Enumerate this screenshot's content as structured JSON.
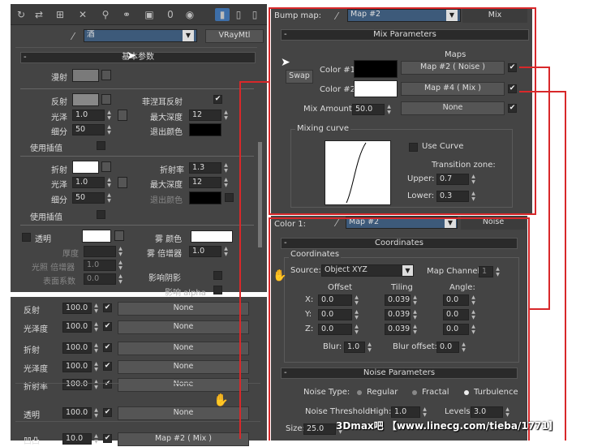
{
  "left": {
    "toolbar_icons": [
      "eyedropper-icon",
      "put-to-scene-icon",
      "assign-icon",
      "reset-icon",
      "copy-icon",
      "unique-icon",
      "put-library-icon",
      "effects-channel-icon",
      "show-map-icon",
      "show-end-icon",
      "go-parent-icon"
    ],
    "effects_channel": "0",
    "material_name": "酒",
    "material_type": "VRayMtl",
    "rollout_title": "基本参数",
    "diffuse_label": "漫射",
    "reflect_label": "反射",
    "fresnel_label": "菲涅耳反射",
    "gloss_label": "光泽",
    "gloss_value": "1.0",
    "max_depth_label": "最大深度",
    "max_depth_value": "12",
    "subdiv_label": "细分",
    "subdiv_value": "50",
    "exit_color_label": "退出颜色",
    "use_interp_label": "使用插值",
    "refract_label": "折射",
    "ior_label": "折射率",
    "ior_value": "1.3",
    "r_gloss_value": "1.0",
    "r_max_depth_value": "12",
    "r_subdiv_value": "50",
    "r_exit_color_label": "退出颜色",
    "r_use_interp_label": "使用插值",
    "translucent_label": "透明",
    "fog_color_label": "雾 颜色",
    "thickness_label": "厚度",
    "fog_mult_label": "雾 倍增器",
    "fog_mult_value": "1.0",
    "light_mult_label": "光照 倍增器",
    "light_mult_value": "1.0",
    "surface_label": "表面系数",
    "surface_value": "0.0",
    "shadow_label": "影响阴影",
    "affect_alpha_label": "影响 alpha"
  },
  "maps": {
    "rows": [
      {
        "label": "反射",
        "value": "100.0",
        "map": "None"
      },
      {
        "label": "光泽度",
        "value": "100.0",
        "map": "None"
      },
      {
        "label": "折射",
        "value": "100.0",
        "map": "None"
      },
      {
        "label": "光泽度",
        "value": "100.0",
        "map": "None"
      },
      {
        "label": "折射率",
        "value": "100.0",
        "map": "None"
      },
      {
        "label": "透明",
        "value": "100.0",
        "map": "None"
      },
      {
        "label": "凹凸",
        "value": "10.0",
        "map": "Map #2 ( Mix )"
      }
    ]
  },
  "mix": {
    "slot_label": "Bump map:",
    "map_name": "Map #2",
    "map_type": "Mix",
    "rollout_title": "Mix Parameters",
    "maps_header": "Maps",
    "swap_label": "Swap",
    "color1_label": "Color #1",
    "color1_map": "Map #2 ( Noise )",
    "color2_label": "Color #2",
    "color2_map": "Map #4 ( Mix )",
    "mix_amount_label": "Mix Amount:",
    "mix_amount_value": "50.0",
    "mix_map": "None",
    "curve_group": "Mixing curve",
    "use_curve_label": "Use Curve",
    "transition_label": "Transition zone:",
    "upper_label": "Upper:",
    "upper_value": "0.7",
    "lower_label": "Lower:",
    "lower_value": "0.3"
  },
  "noise": {
    "slot_label": "Color 1:",
    "map_name": "Map #2",
    "map_type": "Noise",
    "coords_title": "Coordinates",
    "coords_group": "Coordinates",
    "source_label": "Source:",
    "source_value": "Object XYZ",
    "map_channel_label": "Map Channel:",
    "map_channel_value": "1",
    "offset_label": "Offset",
    "tiling_label": "Tiling",
    "angle_label": "Angle:",
    "axes": [
      {
        "axis": "X:",
        "offset": "0.0",
        "tiling": "0.039",
        "angle": "0.0"
      },
      {
        "axis": "Y:",
        "offset": "0.0",
        "tiling": "0.039",
        "angle": "0.0"
      },
      {
        "axis": "Z:",
        "offset": "0.0",
        "tiling": "0.039",
        "angle": "0.0"
      }
    ],
    "blur_label": "Blur:",
    "blur_value": "1.0",
    "blur_offset_label": "Blur offset:",
    "blur_offset_value": "0.0",
    "noise_title": "Noise Parameters",
    "noise_type_label": "Noise Type:",
    "type_regular": "Regular",
    "type_fractal": "Fractal",
    "type_turbulence": "Turbulence",
    "threshold_label": "Noise Threshold:",
    "high_label": "High:",
    "high_value": "1.0",
    "levels_label": "Levels:",
    "levels_value": "3.0",
    "size_label": "Size:",
    "size_value": "25.0"
  },
  "watermark": "3Dmax吧 【www.linecg.com/tieba/1771】"
}
